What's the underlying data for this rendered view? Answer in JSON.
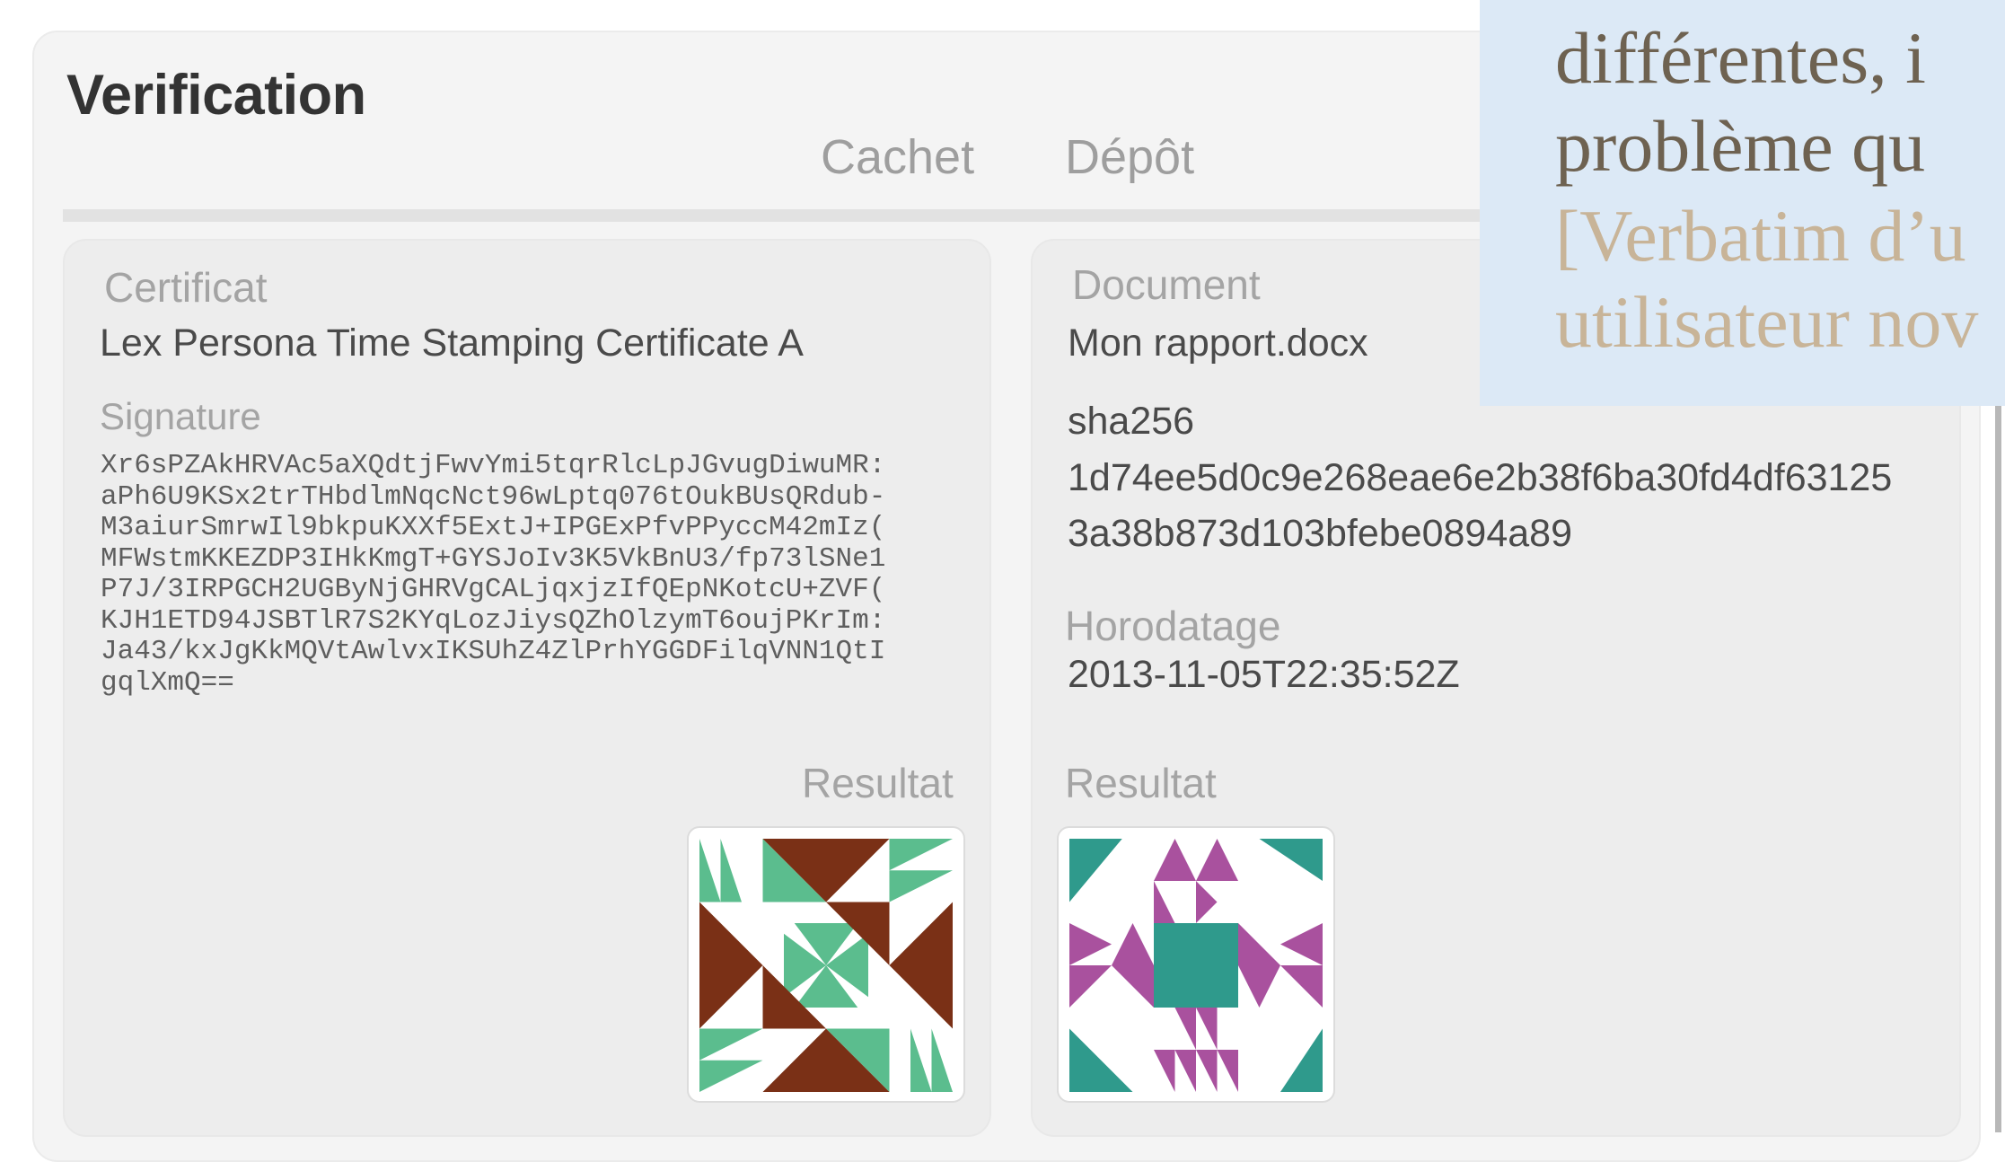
{
  "window": {
    "title": "Verification"
  },
  "tabs": [
    {
      "label": "Cachet"
    },
    {
      "label": "Dépôt"
    }
  ],
  "certificate_panel": {
    "certificat_label": "Certificat",
    "certificat_value": "Lex Persona Time Stamping Certificate A",
    "signature_label": "Signature",
    "signature_value": "Xr6sPZAkHRVAc5aXQdtjFwvYmi5tqrRlcLpJGvugDiwuMR:\naPh6U9KSx2trTHbdlmNqcNct96wLptq076tOukBUsQRdub-\nM3aiurSmrwIl9bkpuKXXf5ExtJ+IPGExPfvPPyccM42mIz(\nMFWstmKKEZDP3IHkKmgT+GYSJoIv3K5VkBnU3/fp73lSNe1\nP7J/3IRPGCH2UGByNjGHRVgCALjqxjzIfQEpNKotcU+ZVF(\nKJH1ETD94JSBTlR7S2KYqLozJiysQZhOlzymT6oujPKrIm:\nJa43/kxJgKkMQVtAwlvxIKSUhZ4ZlPrhYGGDFilqVNN1QtI\ngqlXmQ==",
    "result_label": "Resultat",
    "result_icon": "identicon-pattern-green-brown",
    "colors": {
      "icon_primary": "#5bbd8e",
      "icon_secondary": "#7a3016"
    }
  },
  "document_panel": {
    "document_label": "Document",
    "document_value": "Mon rapport.docx",
    "hash_label": "sha256",
    "hash_line1": "1d74ee5d0c9e268eae6e2b38f6ba30fd4df63125",
    "hash_line2": "3a38b873d103bfebe0894a89",
    "horodatage_label": "Horodatage",
    "horodatage_value": "2013-11-05T22:35:52Z",
    "result_label": "Resultat",
    "result_icon": "identicon-pattern-teal-purple",
    "colors": {
      "icon_primary": "#2f9a8c",
      "icon_secondary": "#a9519e"
    }
  },
  "overlay": {
    "line1": "différentes, i",
    "line2": "problème qu",
    "line3": "[Verbatim d’u",
    "line4": "utilisateur nov",
    "colors": {
      "background": "#dce9f6",
      "primary_text": "#6e6251",
      "secondary_text": "#c8b498"
    }
  }
}
